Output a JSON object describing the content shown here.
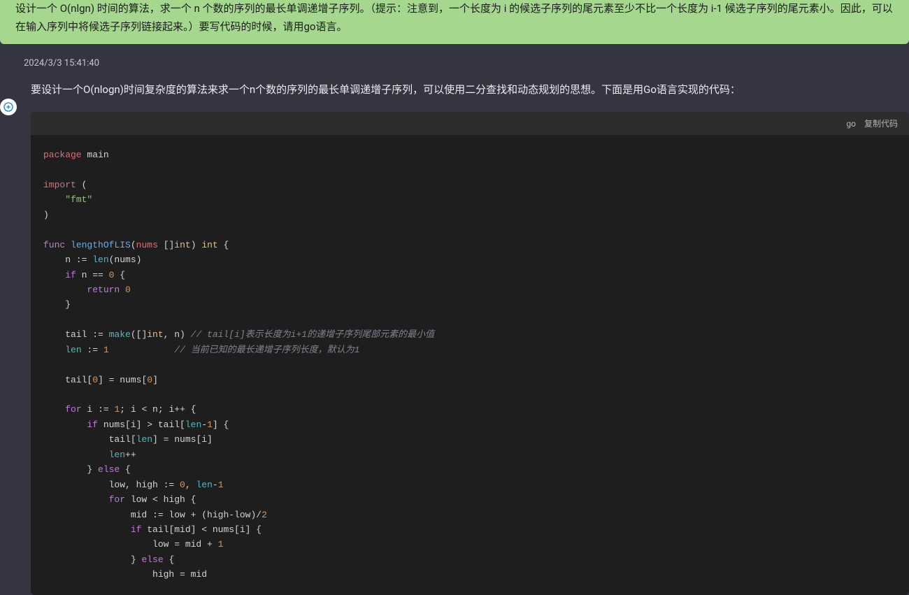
{
  "user_message": "设计一个 O(nlgn) 时间的算法，求一个 n 个数的序列的最长单调递增子序列。（提示：注意到，一个长度为 i 的候选子序列的尾元素至少不比一个长度为 i-1 候选子序列的尾元素小。因此，可以在输入序列中将候选子序列链接起来。）要写代码的时候，请用go语言。",
  "assistant": {
    "timestamp": "2024/3/3 15:41:40",
    "intro_text": "要设计一个O(nlogn)时间复杂度的算法来求一个n个数的序列的最长单调递增子序列，可以使用二分查找和动态规划的思想。下面是用Go语言实现的代码：",
    "code_lang": "go",
    "copy_label": "复制代码",
    "code_tokens": [
      {
        "t": "package",
        "c": "kw2"
      },
      {
        "t": " main\n\n",
        "c": ""
      },
      {
        "t": "import",
        "c": "kw2"
      },
      {
        "t": " (\n    ",
        "c": ""
      },
      {
        "t": "\"fmt\"",
        "c": "str"
      },
      {
        "t": "\n)\n\n",
        "c": ""
      },
      {
        "t": "func",
        "c": "kw"
      },
      {
        "t": " ",
        "c": ""
      },
      {
        "t": "lengthOfLIS",
        "c": "fn"
      },
      {
        "t": "(",
        "c": ""
      },
      {
        "t": "nums",
        "c": "ident"
      },
      {
        "t": " []",
        "c": ""
      },
      {
        "t": "int",
        "c": "typ"
      },
      {
        "t": ") ",
        "c": ""
      },
      {
        "t": "int",
        "c": "typ"
      },
      {
        "t": " {\n",
        "c": ""
      },
      {
        "t": "    n := ",
        "c": ""
      },
      {
        "t": "len",
        "c": "built"
      },
      {
        "t": "(nums)\n",
        "c": ""
      },
      {
        "t": "    ",
        "c": ""
      },
      {
        "t": "if",
        "c": "kw"
      },
      {
        "t": " n == ",
        "c": ""
      },
      {
        "t": "0",
        "c": "num"
      },
      {
        "t": " {\n",
        "c": ""
      },
      {
        "t": "        ",
        "c": ""
      },
      {
        "t": "return",
        "c": "kw"
      },
      {
        "t": " ",
        "c": ""
      },
      {
        "t": "0",
        "c": "num"
      },
      {
        "t": "\n    }\n\n",
        "c": ""
      },
      {
        "t": "    tail := ",
        "c": ""
      },
      {
        "t": "make",
        "c": "built"
      },
      {
        "t": "([]",
        "c": ""
      },
      {
        "t": "int",
        "c": "typ"
      },
      {
        "t": ", n) ",
        "c": ""
      },
      {
        "t": "// tail[i]表示长度为i+1的递增子序列尾部元素的最小值",
        "c": "cmt"
      },
      {
        "t": "\n",
        "c": ""
      },
      {
        "t": "    ",
        "c": ""
      },
      {
        "t": "len",
        "c": "built"
      },
      {
        "t": " := ",
        "c": ""
      },
      {
        "t": "1",
        "c": "num"
      },
      {
        "t": "            ",
        "c": ""
      },
      {
        "t": "// 当前已知的最长递增子序列长度，默认为1",
        "c": "cmt"
      },
      {
        "t": "\n\n",
        "c": ""
      },
      {
        "t": "    tail[",
        "c": ""
      },
      {
        "t": "0",
        "c": "num"
      },
      {
        "t": "] = nums[",
        "c": ""
      },
      {
        "t": "0",
        "c": "num"
      },
      {
        "t": "]\n\n",
        "c": ""
      },
      {
        "t": "    ",
        "c": ""
      },
      {
        "t": "for",
        "c": "kw"
      },
      {
        "t": " i := ",
        "c": ""
      },
      {
        "t": "1",
        "c": "num"
      },
      {
        "t": "; i < n; i++ {\n",
        "c": ""
      },
      {
        "t": "        ",
        "c": ""
      },
      {
        "t": "if",
        "c": "kw"
      },
      {
        "t": " nums[i] > tail[",
        "c": ""
      },
      {
        "t": "len",
        "c": "built"
      },
      {
        "t": "-",
        "c": ""
      },
      {
        "t": "1",
        "c": "num"
      },
      {
        "t": "] {\n",
        "c": ""
      },
      {
        "t": "            tail[",
        "c": ""
      },
      {
        "t": "len",
        "c": "built"
      },
      {
        "t": "] = nums[i]\n",
        "c": ""
      },
      {
        "t": "            ",
        "c": ""
      },
      {
        "t": "len",
        "c": "built"
      },
      {
        "t": "++\n",
        "c": ""
      },
      {
        "t": "        } ",
        "c": ""
      },
      {
        "t": "else",
        "c": "kw"
      },
      {
        "t": " {\n",
        "c": ""
      },
      {
        "t": "            low, high := ",
        "c": ""
      },
      {
        "t": "0",
        "c": "num"
      },
      {
        "t": ", ",
        "c": ""
      },
      {
        "t": "len",
        "c": "built"
      },
      {
        "t": "-",
        "c": ""
      },
      {
        "t": "1",
        "c": "num"
      },
      {
        "t": "\n",
        "c": ""
      },
      {
        "t": "            ",
        "c": ""
      },
      {
        "t": "for",
        "c": "kw"
      },
      {
        "t": " low < high {\n",
        "c": ""
      },
      {
        "t": "                mid := low + (high-low)/",
        "c": ""
      },
      {
        "t": "2",
        "c": "num"
      },
      {
        "t": "\n",
        "c": ""
      },
      {
        "t": "                ",
        "c": ""
      },
      {
        "t": "if",
        "c": "kw"
      },
      {
        "t": " tail[mid] < nums[i] {\n",
        "c": ""
      },
      {
        "t": "                    low = mid + ",
        "c": ""
      },
      {
        "t": "1",
        "c": "num"
      },
      {
        "t": "\n",
        "c": ""
      },
      {
        "t": "                } ",
        "c": ""
      },
      {
        "t": "else",
        "c": "kw"
      },
      {
        "t": " {\n",
        "c": ""
      },
      {
        "t": "                    high = mid",
        "c": ""
      }
    ]
  }
}
